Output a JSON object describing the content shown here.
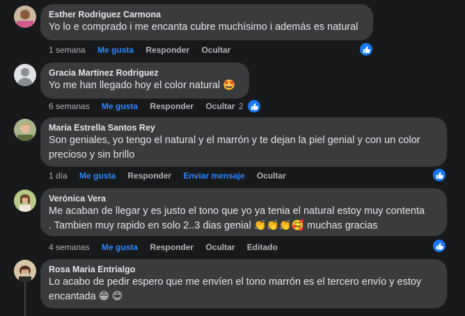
{
  "colors": {
    "background": "#18191a",
    "bubble": "#3a3b3c",
    "link_blue": "#2d88ff",
    "like_blue": "#1877f2",
    "muted": "#b0b3b8"
  },
  "comments": [
    {
      "author": "Esther Rodriguez Carmona",
      "lines": [
        "Yo lo e comprado i me encanta cubre muchísimo i además es natural"
      ],
      "time": "1 semana",
      "like": "Me gusta",
      "reply": "Responder",
      "hide": "Ocultar",
      "reaction_icon": "like-icon"
    },
    {
      "author": "Gracia Martínez Rodriguez",
      "lines": [
        "Yo me han llegado hoy el color natural 🤩"
      ],
      "time": "6 semanas",
      "like": "Me gusta",
      "reply": "Responder",
      "hide": "Ocultar",
      "reaction_count": "2",
      "reaction_icon": "like-icon"
    },
    {
      "author": "María Estrella Santos Rey",
      "lines": [
        "Son geniales, yo tengo el natural y el marrón y te dejan la piel genial y con un color",
        "precioso y sin brillo"
      ],
      "time": "1 día",
      "like": "Me gusta",
      "reply": "Responder",
      "message": "Enviar mensaje",
      "hide": "Ocultar",
      "reaction_icon": "like-icon"
    },
    {
      "author": "Verónica Vera",
      "lines": [
        "Me acaban de llegar y es justo el tono que yo ya tenia el natural estoy muy contenta",
        ". Tambien muy rapido en solo 2..3 dias genial 👏👏👏🥰 muchas gracias"
      ],
      "time": "4 semanas",
      "like": "Me gusta",
      "reply": "Responder",
      "hide": "Ocultar",
      "edited": "Editado",
      "reaction_icon": "like-icon"
    },
    {
      "author": "Rosa Maria Entrialgo",
      "lines": [
        "Lo acabo de pedir espero que me envíen el tono marrón es el tercero envío y estoy",
        "encantada 😁 😊"
      ]
    }
  ]
}
